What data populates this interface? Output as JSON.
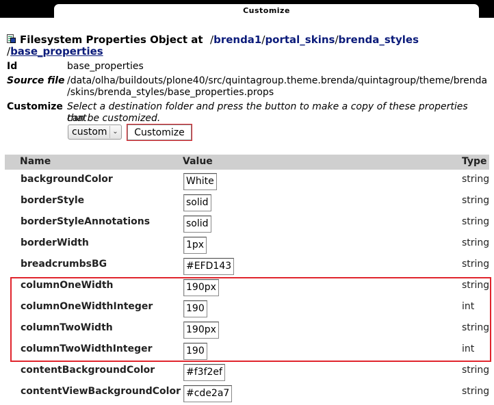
{
  "window": {
    "title": "Customize"
  },
  "header": {
    "prefix": "Filesystem Properties Object at",
    "path": [
      "brenda1",
      "portal_skins",
      "brenda_styles",
      "base_properties"
    ],
    "separator": "/"
  },
  "info": {
    "id_label": "Id",
    "id_value": "base_properties",
    "source_label": "Source file",
    "source_line1": "/data/olha/buildouts/plone40/src/quintagroup.theme.brenda/quintagroup/theme/brenda",
    "source_line2": "/skins/brenda_styles/base_properties.props",
    "customize_label": "Customize",
    "customize_desc_line1": "Select a destination folder and press the button to make a copy of these properties that",
    "customize_desc_line2": "can be customized.",
    "folder_select": "custom",
    "customize_button": "Customize"
  },
  "table": {
    "headers": {
      "name": "Name",
      "value": "Value",
      "type": "Type"
    },
    "rows": [
      {
        "name": "backgroundColor",
        "value": "White",
        "type": "string"
      },
      {
        "name": "borderStyle",
        "value": "solid",
        "type": "string"
      },
      {
        "name": "borderStyleAnnotations",
        "value": "solid",
        "type": "string"
      },
      {
        "name": "borderWidth",
        "value": "1px",
        "type": "string"
      },
      {
        "name": "breadcrumbsBG",
        "value": "#EFD143",
        "type": "string"
      },
      {
        "name": "columnOneWidth",
        "value": "190px",
        "type": "string"
      },
      {
        "name": "columnOneWidthInteger",
        "value": "190",
        "type": "int"
      },
      {
        "name": "columnTwoWidth",
        "value": "190px",
        "type": "string"
      },
      {
        "name": "columnTwoWidthInteger",
        "value": "190",
        "type": "int"
      },
      {
        "name": "contentBackgroundColor",
        "value": "#f3f2ef",
        "type": "string"
      },
      {
        "name": "contentViewBackgroundColor",
        "value": "#cde2a7",
        "type": "string"
      }
    ]
  },
  "colors": {
    "highlight": "#e0242c",
    "link": "#0b1b7a",
    "header_bg": "#cfcfcf"
  }
}
